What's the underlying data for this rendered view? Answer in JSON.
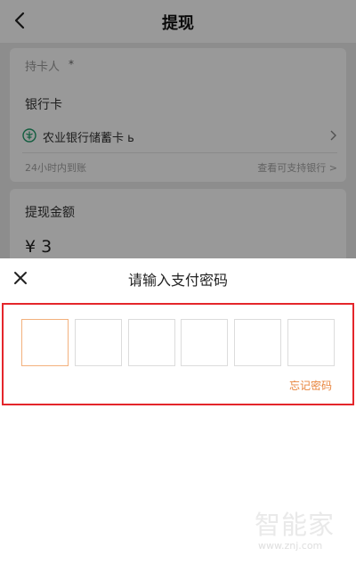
{
  "header": {
    "title": "提现"
  },
  "withdraw_form": {
    "holder_label": "持卡人",
    "holder_required_mark": "*",
    "bank_card_label": "银行卡",
    "bank_name": "农业银行储蓄卡 ь",
    "arrival_time": "24小时内到账",
    "supported_banks_link": "查看可支持银行 >",
    "amount_label": "提现金额",
    "amount_value": "¥ 3"
  },
  "password_sheet": {
    "title": "请输入支付密码",
    "pin_length": 6,
    "forgot_password_link": "忘记密码"
  },
  "watermark": {
    "logo": "智能家",
    "url": "www.znj.com"
  },
  "colors": {
    "accent_orange": "#e8843c",
    "highlight_red": "#e4262b",
    "active_pin_border": "#f3b17d"
  },
  "icons": {
    "back": "back-arrow-icon",
    "bank": "abc-bank-icon",
    "chevron": "chevron-right-icon",
    "close": "close-icon"
  }
}
